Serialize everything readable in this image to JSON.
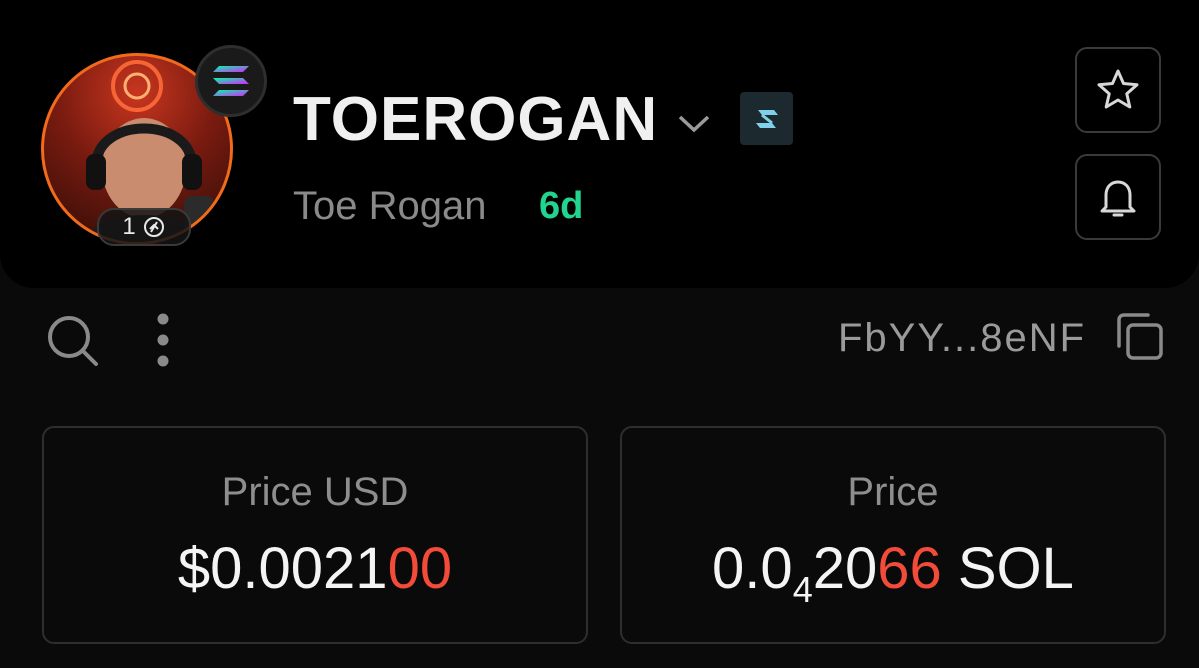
{
  "token": {
    "symbol": "TOEROGAN",
    "name": "Toe Rogan",
    "age": "6d",
    "boost_count": "1"
  },
  "contract": {
    "address_short": "FbYY...8eNF"
  },
  "price_usd": {
    "label": "Price USD",
    "prefix": "$0.0021",
    "highlight": "00"
  },
  "price_native": {
    "label": "Price",
    "lead": "0.0",
    "subscript_zeros": "4",
    "mid": "20",
    "highlight": "66",
    "unit": "SOL"
  },
  "icons": {
    "chain": "solana-icon",
    "dex": "dex-icon",
    "star": "star-icon",
    "bell": "bell-icon",
    "search": "search-icon",
    "more": "more-vertical-icon",
    "copy": "copy-icon",
    "chevron": "chevron-down-icon"
  },
  "colors": {
    "background": "#0a0a0a",
    "accent_green": "#21d48f",
    "accent_red": "#f24b3a",
    "avatar_ring": "#f26a1b"
  }
}
